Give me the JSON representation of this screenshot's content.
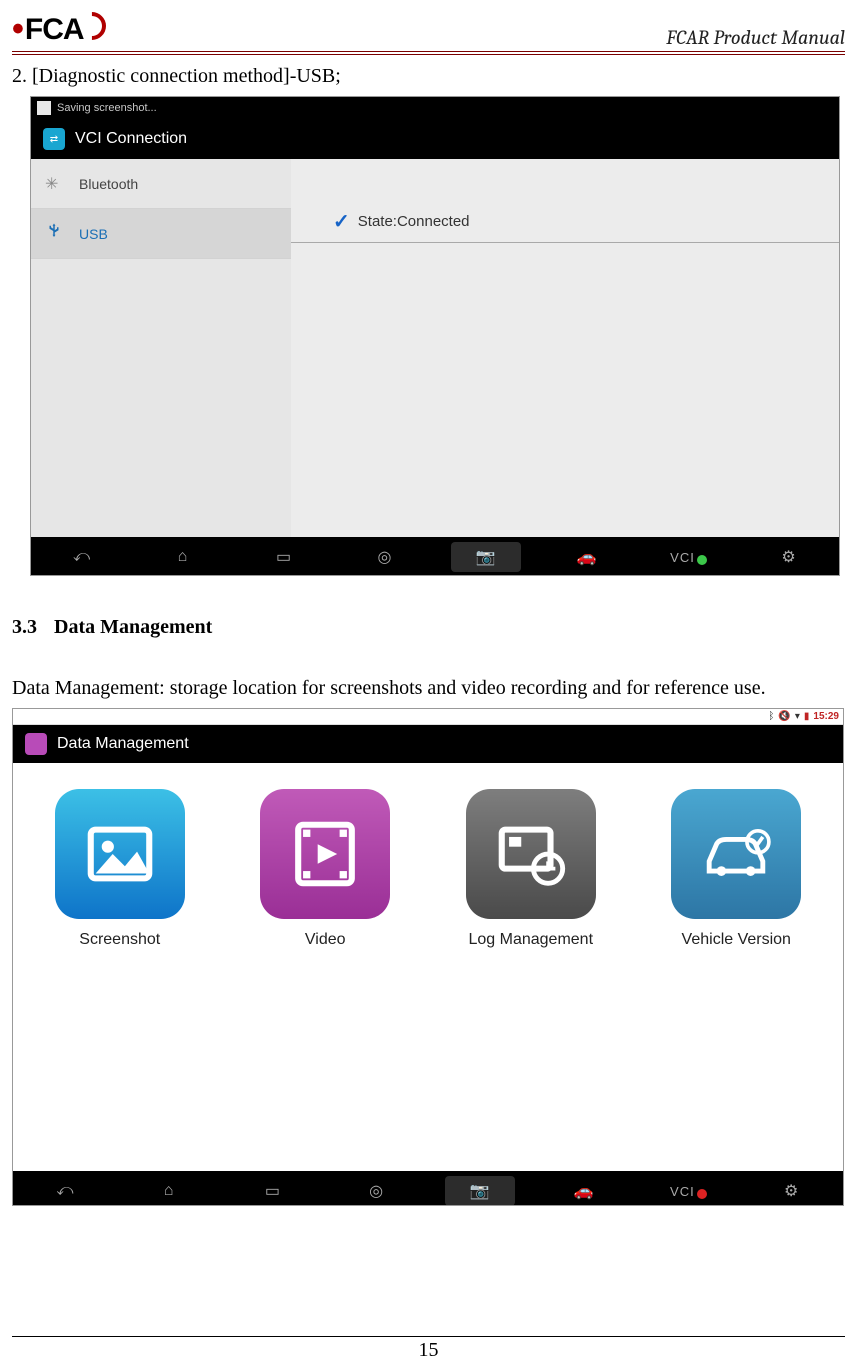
{
  "header": {
    "logo_text": "FCA",
    "manual_title": "FCAR Product Manual"
  },
  "step_text": "2. [Diagnostic connection method]-USB;",
  "shot1": {
    "status": "Saving screenshot...",
    "appbar_title": "VCI Connection",
    "sidebar": [
      {
        "icon": "bluetooth-icon",
        "label": "Bluetooth",
        "selected": false
      },
      {
        "icon": "usb-icon",
        "label": "USB",
        "selected": true
      }
    ],
    "state_label": "State:Connected",
    "nav_vci_label": "VCI"
  },
  "section": {
    "number": "3.3",
    "title": "Data Management"
  },
  "section_desc": "Data Management: storage location for screenshots and video recording and for reference use.",
  "shot2": {
    "clock": "15:29",
    "appbar_title": "Data Management",
    "tiles": [
      {
        "name": "screenshot-tile",
        "label": "Screenshot",
        "grad": "grad-blue"
      },
      {
        "name": "video-tile",
        "label": "Video",
        "grad": "grad-pink"
      },
      {
        "name": "log-management-tile",
        "label": "Log Management",
        "grad": "grad-gray"
      },
      {
        "name": "vehicle-version-tile",
        "label": "Vehicle Version",
        "grad": "grad-teal"
      }
    ],
    "nav_vci_label": "VCI"
  },
  "page_number": "15"
}
